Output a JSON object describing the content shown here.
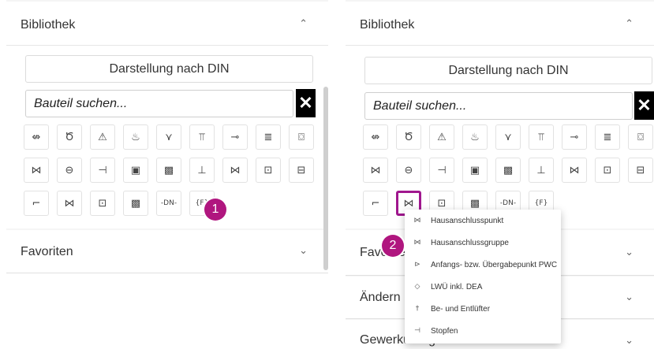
{
  "left": {
    "library_title": "Bibliothek",
    "din_button": "Darstellung nach DIN",
    "search_value": "Bauteil suchen...",
    "favorites_title": "Favoriten",
    "badge": "1",
    "icons_row1": [
      "⇎",
      "Ծ",
      "⚠",
      "♨",
      "⋎",
      "⫪",
      "⊸",
      "≣",
      "⌼"
    ],
    "icons_row2": [
      "⋈",
      "⊖",
      "⊣",
      "▣",
      "▩",
      "⊥",
      "⋈",
      "⊡",
      "⊟"
    ],
    "icons_row3": [
      "⌐",
      "⋈",
      "⊡",
      "▩",
      "-DN-",
      "{F}"
    ]
  },
  "right": {
    "library_title": "Bibliothek",
    "din_button": "Darstellung nach DIN",
    "search_value": "Bauteil suchen...",
    "favorites_title": "Favoriten",
    "aendern_title": "Ändern (",
    "gewerk_title": "Gewerkübergreifend",
    "badge": "2",
    "icons_row1": [
      "⇎",
      "Ծ",
      "⚠",
      "♨",
      "⋎",
      "⫪",
      "⊸",
      "≣",
      "⌼"
    ],
    "icons_row2": [
      "⋈",
      "⊖",
      "⊣",
      "▣",
      "▩",
      "⊥",
      "⋈",
      "⊡",
      "⊟"
    ],
    "icons_row3": [
      "⌐",
      "⋈",
      "⊡",
      "▩",
      "-DN-",
      "{F}"
    ]
  },
  "dropdown": {
    "items": [
      {
        "icon": "⋈",
        "label": "Hausanschlusspunkt"
      },
      {
        "icon": "⋈",
        "label": "Hausanschlussgruppe"
      },
      {
        "icon": "⊳",
        "label": "Anfangs- bzw. Übergabepunkt PWC"
      },
      {
        "icon": "◇",
        "label": "LWÜ inkl. DEA"
      },
      {
        "icon": "†",
        "label": "Be- und Entlüfter"
      },
      {
        "icon": "⊣",
        "label": "Stopfen"
      }
    ]
  }
}
